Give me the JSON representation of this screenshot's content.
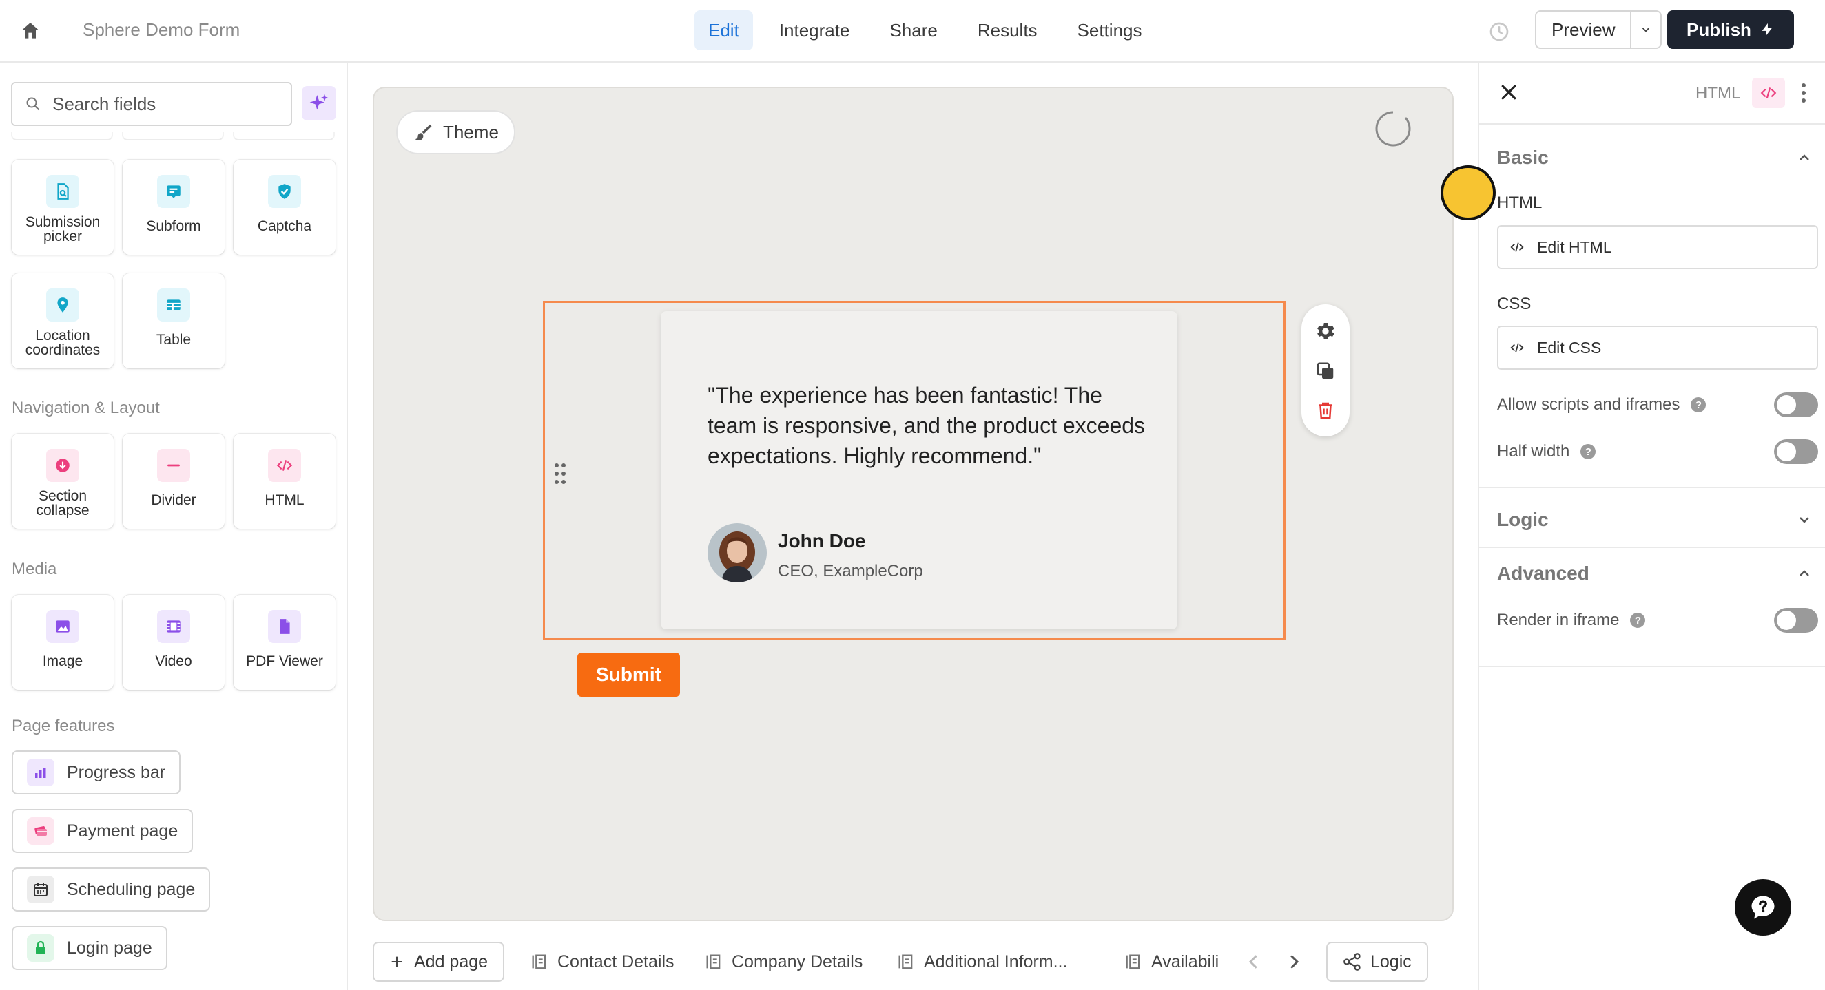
{
  "header": {
    "form_title": "Sphere Demo Form",
    "tabs": [
      {
        "label": "Edit",
        "active": true
      },
      {
        "label": "Integrate",
        "active": false
      },
      {
        "label": "Share",
        "active": false
      },
      {
        "label": "Results",
        "active": false
      },
      {
        "label": "Settings",
        "active": false
      }
    ],
    "preview_label": "Preview",
    "publish_label": "Publish"
  },
  "sidebar": {
    "search_placeholder": "Search fields",
    "fields": [
      {
        "label": "Submission picker",
        "icon": "file-search-icon"
      },
      {
        "label": "Subform",
        "icon": "subform-icon"
      },
      {
        "label": "Captcha",
        "icon": "shield-check-icon"
      },
      {
        "label": "Location coordinates",
        "icon": "map-pin-icon"
      },
      {
        "label": "Table",
        "icon": "table-icon"
      }
    ],
    "nav_section": "Navigation & Layout",
    "nav_items": [
      {
        "label": "Section collapse",
        "icon": "collapse-icon"
      },
      {
        "label": "Divider",
        "icon": "divider-icon"
      },
      {
        "label": "HTML",
        "icon": "code-icon"
      }
    ],
    "media_section": "Media",
    "media_items": [
      {
        "label": "Image",
        "icon": "image-icon"
      },
      {
        "label": "Video",
        "icon": "film-icon"
      },
      {
        "label": "PDF Viewer",
        "icon": "file-icon"
      }
    ],
    "page_features_section": "Page features",
    "page_features": [
      {
        "label": "Progress bar",
        "icon": "bar-chart-icon"
      },
      {
        "label": "Payment page",
        "icon": "credit-card-icon"
      },
      {
        "label": "Scheduling page",
        "icon": "calendar-icon"
      },
      {
        "label": "Login page",
        "icon": "lock-icon"
      }
    ]
  },
  "canvas": {
    "theme_label": "Theme",
    "testimonial": {
      "quote": "\"The experience has been fantastic! The team is responsive, and the product exceeds expectations. Highly recommend.\"",
      "name": "John Doe",
      "role": "CEO, ExampleCorp"
    },
    "submit_label": "Submit"
  },
  "pages": {
    "add_page_label": "Add page",
    "tabs": [
      "Contact Details",
      "Company Details",
      "Additional Inform...",
      "Availabili"
    ],
    "logic_label": "Logic"
  },
  "panel": {
    "element_type": "HTML",
    "basic_section": "Basic",
    "html_label": "HTML",
    "edit_html_label": "Edit HTML",
    "css_label": "CSS",
    "edit_css_label": "Edit CSS",
    "allow_scripts_label": "Allow scripts and iframes",
    "allow_scripts_on": false,
    "half_width_label": "Half width",
    "half_width_on": false,
    "logic_section": "Logic",
    "advanced_section": "Advanced",
    "render_iframe_label": "Render in iframe",
    "render_iframe_on": false
  },
  "colors": {
    "accent": "#1b72d8",
    "submit": "#f76b11",
    "selection_border": "#f58a4d",
    "publish_bg": "#1e2430"
  }
}
